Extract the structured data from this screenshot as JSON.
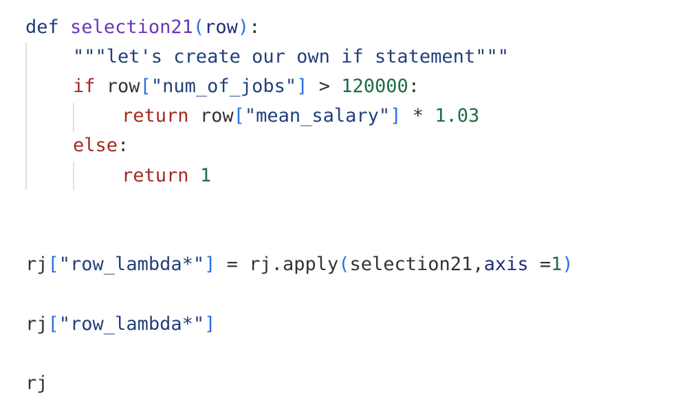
{
  "code": {
    "line1": {
      "kw": "def",
      "fn": "selection21",
      "open": "(",
      "param": "row",
      "close": ")",
      "colon": ":"
    },
    "line2": {
      "docstring": "\"\"\"let's create our own if statement\"\"\""
    },
    "line3": {
      "kw": "if",
      "var": "row",
      "open": "[",
      "key": "\"num_of_jobs\"",
      "close": "]",
      "op": ">",
      "num": "120000",
      "colon": ":"
    },
    "line4": {
      "kw": "return",
      "var": "row",
      "open": "[",
      "key": "\"mean_salary\"",
      "close": "]",
      "op": "*",
      "num": "1.03"
    },
    "line5": {
      "kw": "else",
      "colon": ":"
    },
    "line6": {
      "kw": "return",
      "num": "1"
    },
    "line7": {
      "var": "rj",
      "open": "[",
      "key": "\"row_lambda*\"",
      "close": "]",
      "eq": "=",
      "call": "rj.apply",
      "popen": "(",
      "arg": "selection21,",
      "kwarg": "axis",
      "kweq": "=",
      "num": "1",
      "pclose": ")"
    },
    "line8": {
      "var": "rj",
      "open": "[",
      "key": "\"row_lambda*\"",
      "close": "]"
    },
    "line9": {
      "var": "rj"
    }
  },
  "colors": {
    "keyword_def": "#1f3a7a",
    "keyword_control": "#a32a1e",
    "function_name": "#6a35b8",
    "string": "#213f7a",
    "number": "#1e6b44",
    "bracket": "#2c6fe0"
  }
}
